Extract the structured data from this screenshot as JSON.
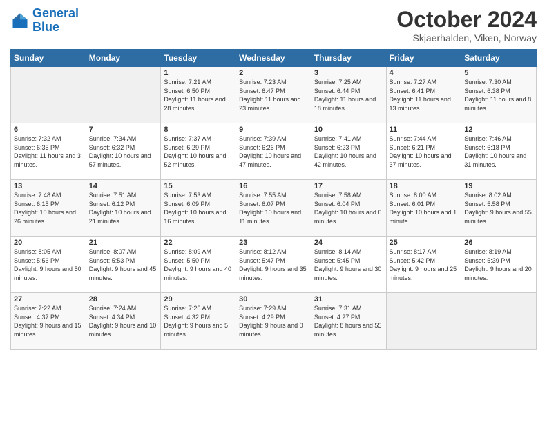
{
  "header": {
    "logo_general": "General",
    "logo_blue": "Blue",
    "title": "October 2024",
    "location": "Skjaerhalden, Viken, Norway"
  },
  "days_of_week": [
    "Sunday",
    "Monday",
    "Tuesday",
    "Wednesday",
    "Thursday",
    "Friday",
    "Saturday"
  ],
  "weeks": [
    [
      {
        "day": "",
        "sunrise": "",
        "sunset": "",
        "daylight": "",
        "empty": true
      },
      {
        "day": "",
        "sunrise": "",
        "sunset": "",
        "daylight": "",
        "empty": true
      },
      {
        "day": "1",
        "sunrise": "Sunrise: 7:21 AM",
        "sunset": "Sunset: 6:50 PM",
        "daylight": "Daylight: 11 hours and 28 minutes."
      },
      {
        "day": "2",
        "sunrise": "Sunrise: 7:23 AM",
        "sunset": "Sunset: 6:47 PM",
        "daylight": "Daylight: 11 hours and 23 minutes."
      },
      {
        "day": "3",
        "sunrise": "Sunrise: 7:25 AM",
        "sunset": "Sunset: 6:44 PM",
        "daylight": "Daylight: 11 hours and 18 minutes."
      },
      {
        "day": "4",
        "sunrise": "Sunrise: 7:27 AM",
        "sunset": "Sunset: 6:41 PM",
        "daylight": "Daylight: 11 hours and 13 minutes."
      },
      {
        "day": "5",
        "sunrise": "Sunrise: 7:30 AM",
        "sunset": "Sunset: 6:38 PM",
        "daylight": "Daylight: 11 hours and 8 minutes."
      }
    ],
    [
      {
        "day": "6",
        "sunrise": "Sunrise: 7:32 AM",
        "sunset": "Sunset: 6:35 PM",
        "daylight": "Daylight: 11 hours and 3 minutes."
      },
      {
        "day": "7",
        "sunrise": "Sunrise: 7:34 AM",
        "sunset": "Sunset: 6:32 PM",
        "daylight": "Daylight: 10 hours and 57 minutes."
      },
      {
        "day": "8",
        "sunrise": "Sunrise: 7:37 AM",
        "sunset": "Sunset: 6:29 PM",
        "daylight": "Daylight: 10 hours and 52 minutes."
      },
      {
        "day": "9",
        "sunrise": "Sunrise: 7:39 AM",
        "sunset": "Sunset: 6:26 PM",
        "daylight": "Daylight: 10 hours and 47 minutes."
      },
      {
        "day": "10",
        "sunrise": "Sunrise: 7:41 AM",
        "sunset": "Sunset: 6:23 PM",
        "daylight": "Daylight: 10 hours and 42 minutes."
      },
      {
        "day": "11",
        "sunrise": "Sunrise: 7:44 AM",
        "sunset": "Sunset: 6:21 PM",
        "daylight": "Daylight: 10 hours and 37 minutes."
      },
      {
        "day": "12",
        "sunrise": "Sunrise: 7:46 AM",
        "sunset": "Sunset: 6:18 PM",
        "daylight": "Daylight: 10 hours and 31 minutes."
      }
    ],
    [
      {
        "day": "13",
        "sunrise": "Sunrise: 7:48 AM",
        "sunset": "Sunset: 6:15 PM",
        "daylight": "Daylight: 10 hours and 26 minutes."
      },
      {
        "day": "14",
        "sunrise": "Sunrise: 7:51 AM",
        "sunset": "Sunset: 6:12 PM",
        "daylight": "Daylight: 10 hours and 21 minutes."
      },
      {
        "day": "15",
        "sunrise": "Sunrise: 7:53 AM",
        "sunset": "Sunset: 6:09 PM",
        "daylight": "Daylight: 10 hours and 16 minutes."
      },
      {
        "day": "16",
        "sunrise": "Sunrise: 7:55 AM",
        "sunset": "Sunset: 6:07 PM",
        "daylight": "Daylight: 10 hours and 11 minutes."
      },
      {
        "day": "17",
        "sunrise": "Sunrise: 7:58 AM",
        "sunset": "Sunset: 6:04 PM",
        "daylight": "Daylight: 10 hours and 6 minutes."
      },
      {
        "day": "18",
        "sunrise": "Sunrise: 8:00 AM",
        "sunset": "Sunset: 6:01 PM",
        "daylight": "Daylight: 10 hours and 1 minute."
      },
      {
        "day": "19",
        "sunrise": "Sunrise: 8:02 AM",
        "sunset": "Sunset: 5:58 PM",
        "daylight": "Daylight: 9 hours and 55 minutes."
      }
    ],
    [
      {
        "day": "20",
        "sunrise": "Sunrise: 8:05 AM",
        "sunset": "Sunset: 5:56 PM",
        "daylight": "Daylight: 9 hours and 50 minutes."
      },
      {
        "day": "21",
        "sunrise": "Sunrise: 8:07 AM",
        "sunset": "Sunset: 5:53 PM",
        "daylight": "Daylight: 9 hours and 45 minutes."
      },
      {
        "day": "22",
        "sunrise": "Sunrise: 8:09 AM",
        "sunset": "Sunset: 5:50 PM",
        "daylight": "Daylight: 9 hours and 40 minutes."
      },
      {
        "day": "23",
        "sunrise": "Sunrise: 8:12 AM",
        "sunset": "Sunset: 5:47 PM",
        "daylight": "Daylight: 9 hours and 35 minutes."
      },
      {
        "day": "24",
        "sunrise": "Sunrise: 8:14 AM",
        "sunset": "Sunset: 5:45 PM",
        "daylight": "Daylight: 9 hours and 30 minutes."
      },
      {
        "day": "25",
        "sunrise": "Sunrise: 8:17 AM",
        "sunset": "Sunset: 5:42 PM",
        "daylight": "Daylight: 9 hours and 25 minutes."
      },
      {
        "day": "26",
        "sunrise": "Sunrise: 8:19 AM",
        "sunset": "Sunset: 5:39 PM",
        "daylight": "Daylight: 9 hours and 20 minutes."
      }
    ],
    [
      {
        "day": "27",
        "sunrise": "Sunrise: 7:22 AM",
        "sunset": "Sunset: 4:37 PM",
        "daylight": "Daylight: 9 hours and 15 minutes."
      },
      {
        "day": "28",
        "sunrise": "Sunrise: 7:24 AM",
        "sunset": "Sunset: 4:34 PM",
        "daylight": "Daylight: 9 hours and 10 minutes."
      },
      {
        "day": "29",
        "sunrise": "Sunrise: 7:26 AM",
        "sunset": "Sunset: 4:32 PM",
        "daylight": "Daylight: 9 hours and 5 minutes."
      },
      {
        "day": "30",
        "sunrise": "Sunrise: 7:29 AM",
        "sunset": "Sunset: 4:29 PM",
        "daylight": "Daylight: 9 hours and 0 minutes."
      },
      {
        "day": "31",
        "sunrise": "Sunrise: 7:31 AM",
        "sunset": "Sunset: 4:27 PM",
        "daylight": "Daylight: 8 hours and 55 minutes."
      },
      {
        "day": "",
        "sunrise": "",
        "sunset": "",
        "daylight": "",
        "empty": true
      },
      {
        "day": "",
        "sunrise": "",
        "sunset": "",
        "daylight": "",
        "empty": true
      }
    ]
  ]
}
